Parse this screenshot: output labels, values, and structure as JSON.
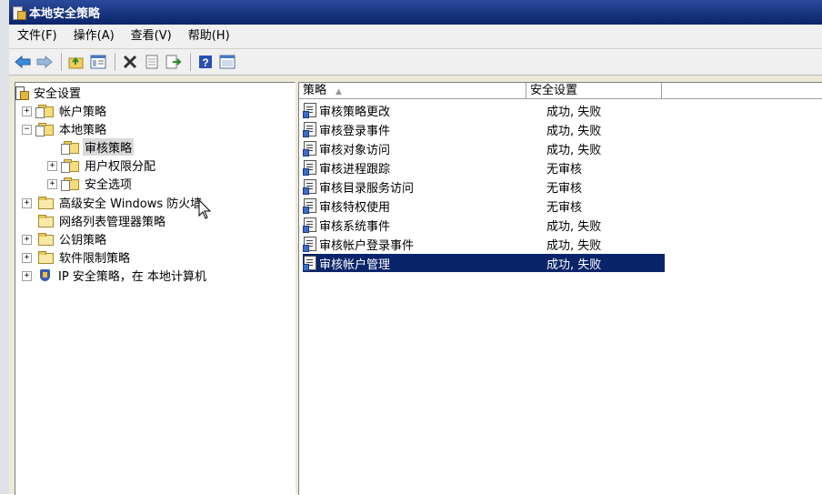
{
  "window": {
    "title": "本地安全策略"
  },
  "menu": [
    "文件(F)",
    "操作(A)",
    "查看(V)",
    "帮助(H)"
  ],
  "toolbar": {
    "buttons": [
      "back-arrow-icon",
      "forward-arrow-icon",
      "up-folder-icon",
      "show-hide-tree-icon",
      "delete-icon",
      "properties-icon",
      "export-list-icon",
      "help-icon",
      "console-icon"
    ],
    "colors": {
      "arrow": "#3b8ad8",
      "delete": "#333333",
      "help": "#2a4fb0"
    }
  },
  "tree": {
    "root": "安全设置",
    "items": [
      {
        "label": "帐户策略",
        "expander": "+"
      },
      {
        "label": "本地策略",
        "expander": "-"
      },
      {
        "label": "审核策略",
        "expander": "",
        "selected": true
      },
      {
        "label": "用户权限分配",
        "expander": "+"
      },
      {
        "label": "安全选项",
        "expander": "+"
      },
      {
        "label": "高级安全 Windows 防火墙",
        "expander": "+"
      },
      {
        "label": "网络列表管理器策略",
        "expander": ""
      },
      {
        "label": "公钥策略",
        "expander": "+"
      },
      {
        "label": "软件限制策略",
        "expander": "+"
      },
      {
        "label": "IP 安全策略，在 本地计算机",
        "expander": "+"
      }
    ]
  },
  "list": {
    "columns": [
      "策略",
      "安全设置"
    ],
    "sort_indicator": "▲",
    "rows": [
      {
        "name": "审核策略更改",
        "setting": "成功, 失败"
      },
      {
        "name": "审核登录事件",
        "setting": "成功, 失败"
      },
      {
        "name": "审核对象访问",
        "setting": "成功, 失败"
      },
      {
        "name": "审核进程跟踪",
        "setting": "无审核"
      },
      {
        "name": "审核目录服务访问",
        "setting": "无审核"
      },
      {
        "name": "审核特权使用",
        "setting": "无审核"
      },
      {
        "name": "审核系统事件",
        "setting": "成功, 失败"
      },
      {
        "name": "审核帐户登录事件",
        "setting": "成功, 失败"
      },
      {
        "name": "审核帐户管理",
        "setting": "成功, 失败",
        "selected": true
      }
    ]
  },
  "colors": {
    "titlebar": "#0a246a",
    "selection": "#0a246a",
    "window_bg": "#ece9d8"
  }
}
